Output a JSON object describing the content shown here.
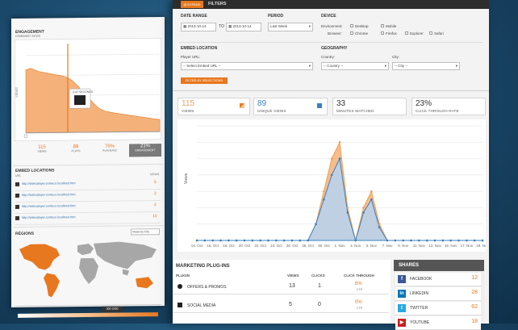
{
  "engagement_panel": {
    "title": "ENGAGEMENT",
    "subtitle": "COMBINED VIEWS",
    "tooltip_text": "0:45 SECONDS",
    "stats": [
      {
        "value": "115",
        "label": "VIEWS"
      },
      {
        "value": "88",
        "label": "PLAYS"
      },
      {
        "value": "76%",
        "label": "PLAYRATE"
      },
      {
        "value": "21%",
        "label": "ENGAGEMENT"
      }
    ]
  },
  "embed_locations": {
    "title": "EMBED LOCATIONS",
    "col_url": "URL",
    "col_views": "VIEWS",
    "rows": [
      {
        "url": "http://videoplayer.someco.localhost.htm",
        "views": "5"
      },
      {
        "url": "http://videoplayer.someco.localhost.htm",
        "views": "2"
      },
      {
        "url": "http://videoplayer.someco.localhost.htm",
        "views": "4"
      },
      {
        "url": "http://videoplayer.someco.localhost.htm",
        "views": "10"
      }
    ]
  },
  "regions": {
    "title": "REGIONS",
    "dropdown": "Views by City",
    "legend_value": "300-1000"
  },
  "toolbar": {
    "expand_label": "EXPAND",
    "filters_label": "FILTERS"
  },
  "filters": {
    "date_range_label": "DATE RANGE",
    "date_from": "2013-10-14",
    "to_label": "TO",
    "date_to": "2013-10-14",
    "period_label": "PERIOD",
    "period_value": "Last Week",
    "device_label": "DEVICE",
    "environment_label": "Environment:",
    "environment_options": [
      "Desktop",
      "Mobile"
    ],
    "browser_label": "Browser:",
    "browser_options": [
      "Chrome",
      "Firefox",
      "Explorer",
      "Safari"
    ],
    "embed_location_label": "EMBED LOCATION",
    "player_url_label": "Player URL:",
    "player_url_value": "-- Select Embed URL --",
    "filter_button": "FILTER BY SELECTIONS",
    "geography_label": "GEOGRAPHY",
    "country_label": "Country:",
    "country_value": "-- Country --",
    "city_label": "City:",
    "city_value": "-- City --"
  },
  "stats": [
    {
      "value": "115",
      "label": "VIEWS",
      "color": "#e8a064"
    },
    {
      "value": "89",
      "label": "UNIQUE VIEWS",
      "color": "#3a7fc0"
    },
    {
      "value": "33",
      "label": "MINUTES WATCHED",
      "color": "#333333"
    },
    {
      "value": "23%",
      "label": "CLICK THROUGH RATE",
      "color": "#333333"
    }
  ],
  "chart_data": {
    "type": "area",
    "ylabel": "Views",
    "categories": [
      "14. Oct",
      "16. Oct",
      "18. Oct",
      "20. Oct",
      "22. Oct",
      "24. Oct",
      "26. Oct",
      "28. Oct",
      "30. Oct",
      "1. Nov",
      "3. Nov",
      "5. Nov",
      "7. Nov",
      "9. Nov",
      "11. Nov",
      "13. Nov",
      "15. Nov",
      "17. Nov",
      "19. Nov"
    ],
    "series": [
      {
        "name": "",
        "color": "#f0a050",
        "values": [
          0,
          0,
          0,
          0,
          0,
          0,
          0,
          0,
          0,
          0,
          0,
          0,
          0,
          0,
          0,
          1,
          3,
          5,
          6,
          2,
          0,
          2,
          3,
          1,
          0,
          0,
          0,
          0,
          0,
          0,
          0,
          0,
          0,
          0,
          0,
          0,
          0
        ]
      },
      {
        "name": "",
        "color": "#3a7fc0",
        "values": [
          0,
          0,
          0,
          0,
          0,
          0,
          0,
          0,
          0,
          0,
          0,
          0,
          0,
          0,
          0,
          1,
          2.5,
          4,
          5,
          1.7,
          0,
          1.7,
          2.5,
          0.8,
          0,
          0,
          0,
          0,
          0,
          0,
          0,
          0,
          0,
          0,
          0,
          0,
          0
        ]
      }
    ]
  },
  "marketing": {
    "title": "MARKETING PLUG-INS",
    "col_plugin": "PLUGIN",
    "col_views": "VIEWS",
    "col_clicks": "CLICKS",
    "col_ctr": "CLICK THROUGH",
    "rows": [
      {
        "name": "OFFERS & PROMOS",
        "views": "13",
        "clicks": "1",
        "ctr": "8%",
        "ctr_sub": "CTR"
      },
      {
        "name": "SOCIAL MEDIA",
        "views": "5",
        "clicks": "0",
        "ctr": "0%",
        "ctr_sub": "CTR"
      }
    ]
  },
  "shares": {
    "title": "SHARES",
    "rows": [
      {
        "name": "FACEBOOK",
        "count": "12",
        "color": "#3b5998",
        "icon": "f"
      },
      {
        "name": "LINKEDIN",
        "count": "28",
        "color": "#0077b5",
        "icon": "in"
      },
      {
        "name": "TWITTER",
        "count": "62",
        "color": "#2aa9e0",
        "icon": "t"
      },
      {
        "name": "YOUTUBE",
        "count": "18",
        "color": "#cc1f1f",
        "icon": "▶"
      }
    ]
  }
}
